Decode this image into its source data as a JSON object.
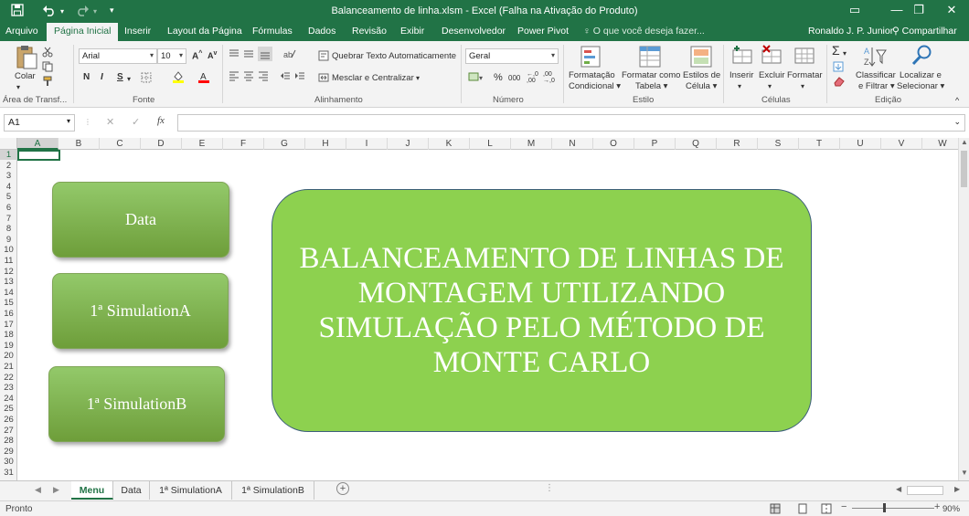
{
  "window": {
    "title": "Balanceamento de linha.xlsm - Excel (Falha na Ativação do Produto)",
    "controls": [
      "▭",
      "—",
      "❐",
      "✕"
    ]
  },
  "quick_access": {
    "save": "save-icon",
    "undo": "undo-icon",
    "redo": "redo-icon",
    "customize": "▾"
  },
  "tabs": [
    "Arquivo",
    "Página Inicial",
    "Inserir",
    "Layout da Página",
    "Fórmulas",
    "Dados",
    "Revisão",
    "Exibir",
    "Desenvolvedor",
    "Power Pivot"
  ],
  "tellme": "O que você deseja fazer...",
  "user": "Ronaldo J. P. Junior",
  "share": "Compartilhar",
  "ribbon": {
    "clipboard": {
      "paste": "Colar",
      "label": "Área de Transf..."
    },
    "font": {
      "name": "Arial",
      "size": "10",
      "grow": "A",
      "shrink": "A",
      "bold": "N",
      "italic": "I",
      "underline": "S",
      "label": "Fonte"
    },
    "alignment": {
      "wrap": "Quebrar Texto Automaticamente",
      "merge": "Mesclar e Centralizar",
      "label": "Alinhamento"
    },
    "number": {
      "format": "Geral",
      "label": "Número"
    },
    "styles": {
      "conditional": "Formatação",
      "conditional2": "Condicional",
      "table": "Formatar como",
      "table2": "Tabela",
      "cell": "Estilos de",
      "cell2": "Célula",
      "label": "Estilo"
    },
    "cells": {
      "insert": "Inserir",
      "delete": "Excluir",
      "format": "Formatar",
      "label": "Células"
    },
    "editing": {
      "sort": "Classificar",
      "sort2": "e Filtrar",
      "find": "Localizar e",
      "find2": "Selecionar",
      "label": "Edição"
    }
  },
  "formula_bar": {
    "name_box": "A1",
    "cancel": "✕",
    "enter": "✓",
    "fx": "fx",
    "value": ""
  },
  "columns": [
    "A",
    "B",
    "C",
    "D",
    "E",
    "F",
    "G",
    "H",
    "I",
    "J",
    "K",
    "L",
    "M",
    "N",
    "O",
    "P",
    "Q",
    "R",
    "S",
    "T",
    "U",
    "V",
    "W"
  ],
  "rows": [
    "1",
    "2",
    "3",
    "4",
    "5",
    "6",
    "7",
    "8",
    "9",
    "10",
    "11",
    "12",
    "13",
    "14",
    "15",
    "16",
    "17",
    "18",
    "19",
    "20",
    "21",
    "22",
    "23",
    "24",
    "25",
    "26",
    "27",
    "28",
    "29",
    "30",
    "31"
  ],
  "shapes": {
    "data": "Data",
    "sim_a": "1ª SimulationA",
    "sim_b": "1ª SimulationB",
    "main": "BALANCEAMENTO DE LINHAS DE MONTAGEM UTILIZANDO SIMULAÇÃO PELO MÉTODO DE MONTE CARLO"
  },
  "sheets": [
    "Menu",
    "Data",
    "1ª SimulationA",
    "1ª SimulationB"
  ],
  "add_sheet": "+",
  "status": "Pronto",
  "zoom": "90%",
  "colors": {
    "excel_green": "#217346",
    "shape_green": "#8dd14f"
  }
}
